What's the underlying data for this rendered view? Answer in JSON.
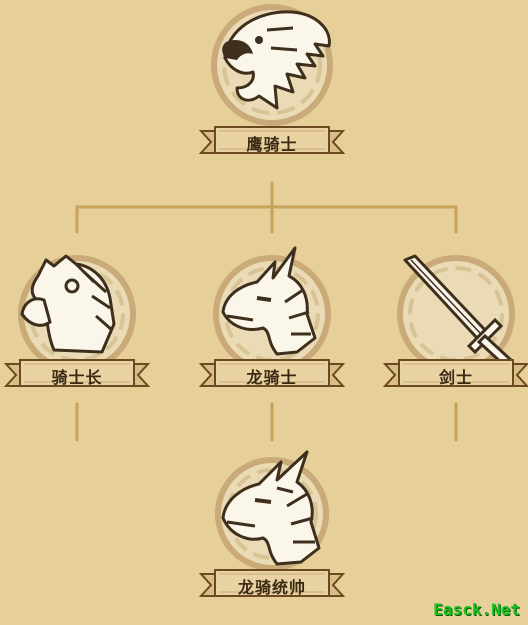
{
  "tree": {
    "root": {
      "label": "鹰骑士",
      "icon": "eagle-head-icon"
    },
    "branches": [
      {
        "label": "骑士长",
        "icon": "horse-head-icon"
      },
      {
        "label": "龙骑士",
        "icon": "dragon-head-icon"
      },
      {
        "label": "剑士",
        "icon": "sword-icon"
      }
    ],
    "final": {
      "label": "龙骑统帅",
      "icon": "armored-dragon-icon"
    }
  },
  "watermark": "Easck.Net",
  "colors": {
    "background": "#e6cf98",
    "connector": "#c9a25c",
    "ribbon_fill": "#e9d3a3",
    "ribbon_edge": "#6b4a22",
    "medallion_ring": "#c9aa78",
    "emblem_white": "#fbf6ea",
    "emblem_dark": "#3e2f1d"
  }
}
